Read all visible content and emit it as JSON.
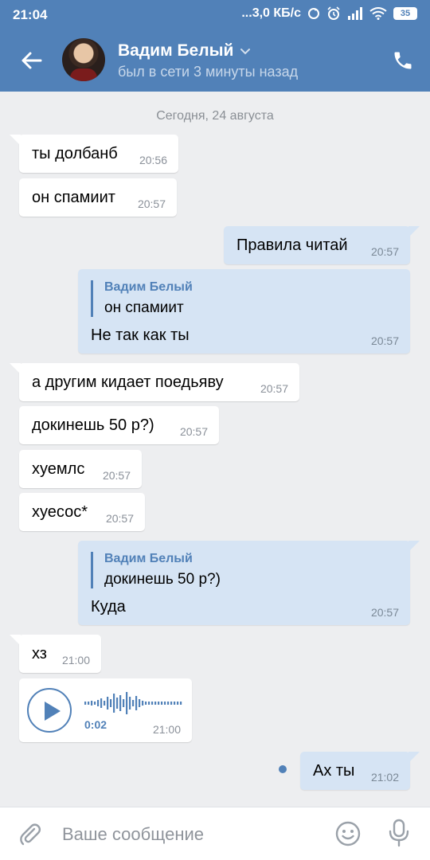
{
  "statusbar": {
    "time": "21:04",
    "network_speed": "...3,0 КБ/с",
    "battery": "35",
    "icons": [
      "sync-icon",
      "alarm-icon",
      "signal-icon",
      "wifi-icon",
      "battery-icon"
    ]
  },
  "header": {
    "name": "Вадим Белый",
    "status": "был в сети 3 минуты назад"
  },
  "date_separator": "Сегодня, 24 августа",
  "messages": [
    {
      "dir": "in",
      "text": "ты долбанб",
      "time": "20:56"
    },
    {
      "dir": "in",
      "text": "он спамиит",
      "time": "20:57"
    },
    {
      "dir": "out",
      "text": "Правила читай",
      "time": "20:57"
    },
    {
      "dir": "out",
      "quote_name": "Вадим Белый",
      "quote_text": "он спамиит",
      "text": "Не так как ты",
      "time": "20:57"
    },
    {
      "dir": "in",
      "text": "а другим кидает поедьяву",
      "time": "20:57"
    },
    {
      "dir": "in",
      "text": "докинешь 50 р?)",
      "time": "20:57"
    },
    {
      "dir": "in",
      "text": "хуемлс",
      "time": "20:57"
    },
    {
      "dir": "in",
      "text": "хуесос*",
      "time": "20:57"
    },
    {
      "dir": "out",
      "quote_name": "Вадим Белый",
      "quote_text": "докинешь 50 р?)",
      "text": "Куда",
      "time": "20:57"
    },
    {
      "dir": "in",
      "text": "хз",
      "time": "21:00"
    },
    {
      "dir": "in",
      "voice": true,
      "duration": "0:02",
      "time": "21:00"
    },
    {
      "dir": "out",
      "text": "Ах ты",
      "time": "21:02",
      "unread": true
    }
  ],
  "input": {
    "placeholder": "Ваше сообщение"
  },
  "colors": {
    "accent": "#5181b8",
    "background": "#edeef0",
    "incoming_bubble": "#ffffff",
    "outgoing_bubble": "#d6e4f4"
  }
}
